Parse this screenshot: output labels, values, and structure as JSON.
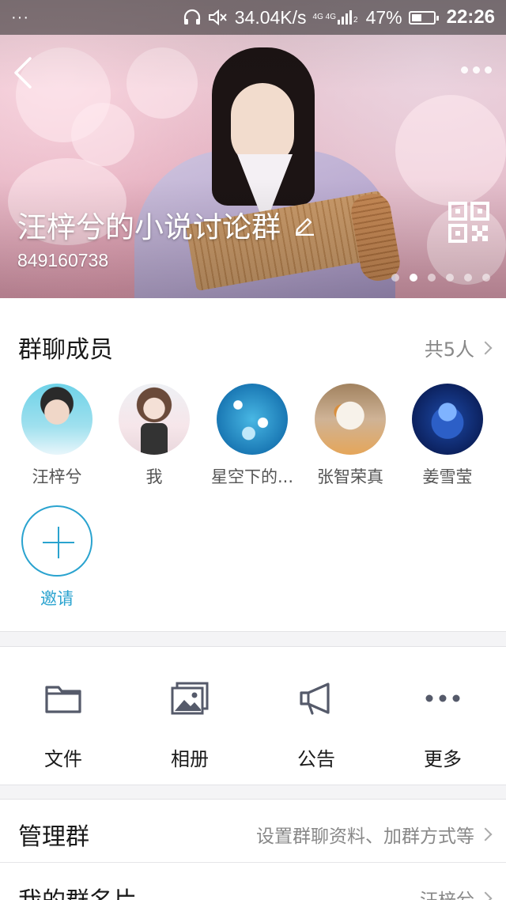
{
  "status_bar": {
    "overflow_dots": "···",
    "net_speed": "34.04K/s",
    "network_type": "4G 4G",
    "sim_index": "2",
    "battery": "47%",
    "battery_level": 0.47,
    "time": "22:26",
    "icons": [
      "headphones-icon",
      "mute-icon",
      "signal-icon",
      "battery-icon"
    ]
  },
  "header": {
    "group_name": "汪梓兮的小说讨论群",
    "group_id": "849160738",
    "carousel": {
      "count": 6,
      "active_index": 1
    }
  },
  "members": {
    "title": "群聊成员",
    "count_label": "共5人",
    "list": [
      {
        "name": "汪梓兮"
      },
      {
        "name": "我"
      },
      {
        "name": "星空下的..."
      },
      {
        "name": "张智荣真"
      },
      {
        "name": "姜雪莹"
      }
    ],
    "invite_label": "邀请"
  },
  "actions": [
    {
      "label": "文件",
      "icon": "folder-icon"
    },
    {
      "label": "相册",
      "icon": "album-icon"
    },
    {
      "label": "公告",
      "icon": "megaphone-icon"
    },
    {
      "label": "更多",
      "icon": "more-icon"
    }
  ],
  "settings": [
    {
      "title": "管理群",
      "value": "设置群聊资料、加群方式等"
    },
    {
      "title": "我的群名片",
      "value": "汪梓兮"
    }
  ],
  "colors": {
    "accent": "#2aa3cf",
    "text_primary": "#1a1a1a",
    "text_secondary": "#888888",
    "section_gap": "#f4f4f6"
  }
}
